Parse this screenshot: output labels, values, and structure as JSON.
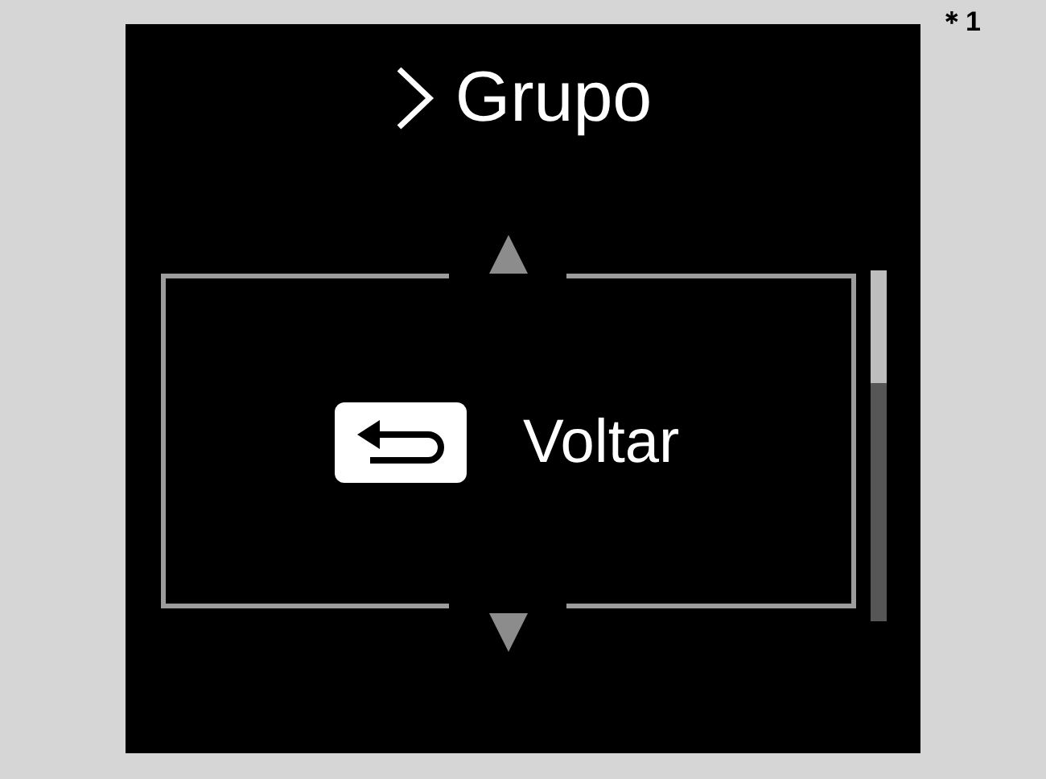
{
  "footnote_mark": "＊1",
  "header": {
    "title": "Grupo"
  },
  "menu": {
    "items": [
      {
        "label": "Voltar",
        "kind": "back"
      }
    ]
  }
}
